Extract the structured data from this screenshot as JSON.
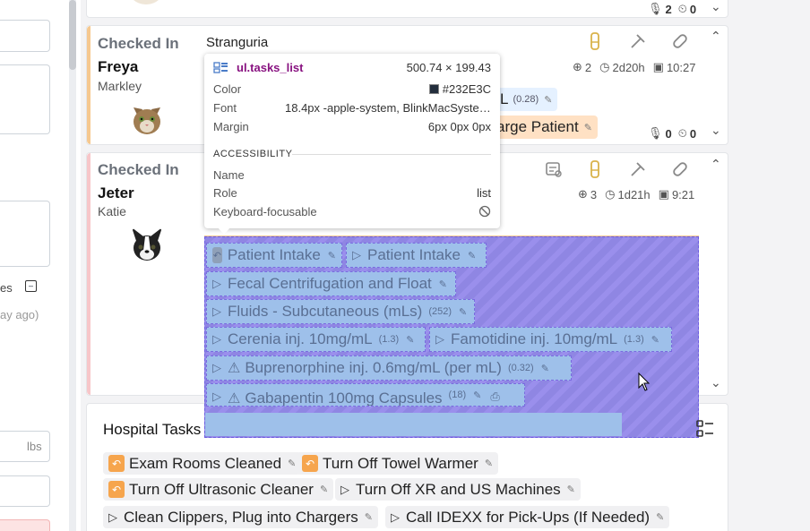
{
  "left_form": {
    "truncated_label": "es",
    "truncated_time": "ay ago)",
    "weight_unit": "lbs"
  },
  "top_card": {
    "mic_count": "2",
    "timer_count": "0"
  },
  "freya_card": {
    "status": "Checked In",
    "name": "Freya",
    "owner": "Markley",
    "reason": "Stranguria",
    "assignees": "2",
    "duration": "2d20h",
    "time": "10:27",
    "task_partial_1": "L",
    "task_partial_1_qty": "(0.28)",
    "task_partial_2": "arge Patient",
    "mic_count": "0",
    "timer_count": "0",
    "accent_color": "#f6c88f"
  },
  "jeter_card": {
    "status": "Checked In",
    "name": "Jeter",
    "owner": "Katie",
    "assignees": "3",
    "duration": "1d21h",
    "time": "9:21",
    "accent_color": "#f7c6c9",
    "tasks": [
      {
        "label": "Patient Intake",
        "qty": ""
      },
      {
        "label": "Patient Intake",
        "qty": ""
      },
      {
        "label": "Fecal Centrifugation and Float",
        "qty": ""
      },
      {
        "label": "Fluids - Subcutaneous (mLs)",
        "qty": "(252)"
      },
      {
        "label": "Cerenia inj. 10mg/mL",
        "qty": "(1.3)"
      },
      {
        "label": "Famotidine inj. 10mg/mL",
        "qty": "(1.3)"
      },
      {
        "label": "Buprenorphine inj. 0.6mg/mL (per mL)",
        "qty": "(0.32)"
      },
      {
        "label": "Gabapentin 100mg Capsules",
        "qty": "(18)"
      }
    ]
  },
  "inspector": {
    "selector": "ul.tasks_list",
    "size": "500.74 × 199.43",
    "color_label": "Color",
    "color_value": "#232E3C",
    "font_label": "Font",
    "font_value": "18.4px -apple-system, BlinkMacSystemFo...",
    "margin_label": "Margin",
    "margin_value": "6px 0px 0px",
    "section": "ACCESSIBILITY",
    "name_label": "Name",
    "name_value": "",
    "role_label": "Role",
    "role_value": "list",
    "keyboard_label": "Keyboard-focusable"
  },
  "hospital_tasks": {
    "title": "Hospital Tasks",
    "items": [
      {
        "label": "Exam Rooms Cleaned",
        "kind": "undo"
      },
      {
        "label": "Turn Off Towel Warmer",
        "kind": "undo"
      },
      {
        "label": "Turn Off Ultrasonic Cleaner",
        "kind": "undo"
      },
      {
        "label": "Turn Off XR and US Machines",
        "kind": "play"
      },
      {
        "label": "Clean Clippers, Plug into Chargers",
        "kind": "play"
      },
      {
        "label": "Call IDEXX for Pick-Ups (If Needed)",
        "kind": "play"
      }
    ]
  }
}
